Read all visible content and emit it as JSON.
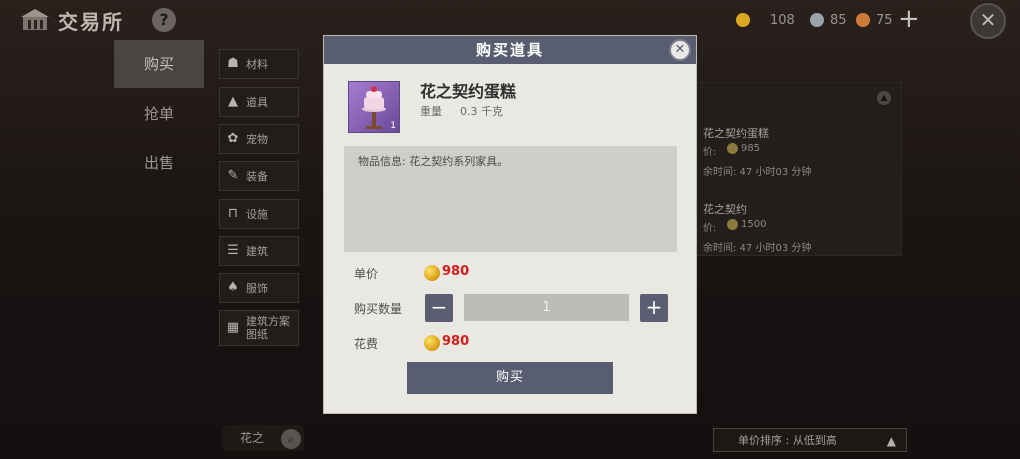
{
  "header": {
    "title": "交易所",
    "help": "?",
    "currencies": [
      {
        "icon": "gold-coin-icon",
        "value": "108",
        "color": "#d9a720"
      },
      {
        "icon": "silver-coin-icon",
        "value": "85",
        "color": "#9aa2ad"
      },
      {
        "icon": "copper-coin-icon",
        "value": "75",
        "color": "#d07a3a"
      }
    ]
  },
  "tabs": [
    "购买",
    "抢单",
    "出售"
  ],
  "categories": [
    "材料",
    "道具",
    "宠物",
    "装备",
    "设施",
    "建筑",
    "服饰",
    "建筑方案\n图纸"
  ],
  "search": {
    "value": "花之"
  },
  "listing": {
    "items": [
      {
        "name": "花之契约蛋糕",
        "price_label": "价:",
        "price": "985",
        "time": "余时间: 47 小时03 分钟"
      },
      {
        "name": "花之契约",
        "price_label": "价:",
        "price": "1500",
        "time": "余时间: 47 小时03 分钟"
      }
    ]
  },
  "sort": {
    "label": "单价排序 : 从低到高"
  },
  "modal": {
    "title": "购买道具",
    "item": {
      "name": "花之契约蛋糕",
      "weight_label": "重量",
      "weight_value": "0.3 千克",
      "count": "1"
    },
    "description": "物品信息: 花之契约系列家具。",
    "unit_price_label": "单价",
    "unit_price": "980",
    "quantity_label": "购买数量",
    "quantity": "1",
    "minus": "−",
    "plus": "+",
    "cost_label": "花费",
    "cost": "980",
    "buy_label": "购买"
  }
}
